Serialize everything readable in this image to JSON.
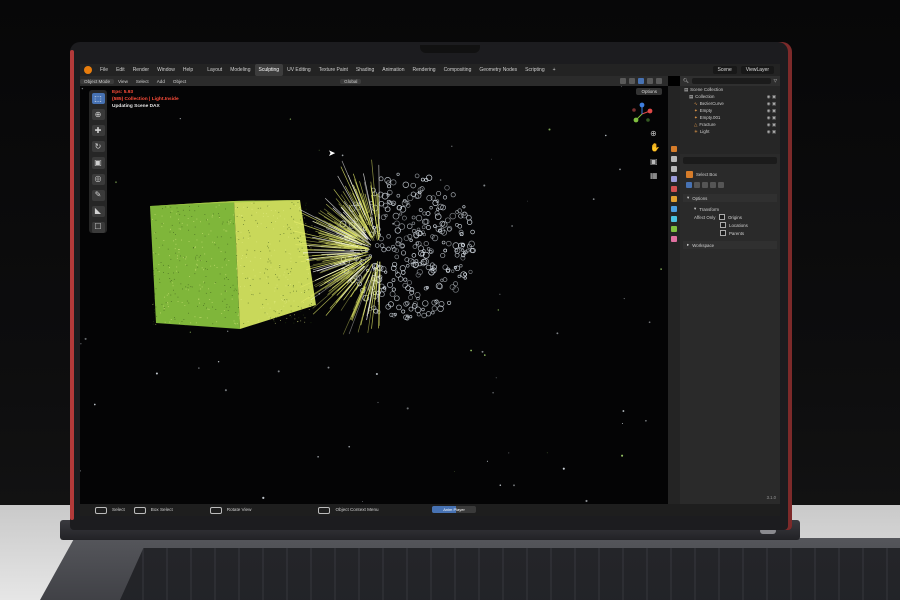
{
  "menubar": {
    "items": [
      "File",
      "Edit",
      "Render",
      "Window",
      "Help"
    ],
    "workspaces": [
      "Layout",
      "Modeling",
      "Sculpting",
      "UV Editing",
      "Texture Paint",
      "Shading",
      "Animation",
      "Rendering",
      "Compositing",
      "Geometry Nodes",
      "Scripting"
    ],
    "active_workspace": "Sculpting",
    "add_tab": "+",
    "scene": "Scene",
    "view_layer": "ViewLayer"
  },
  "viewport_header": {
    "mode": "Object Mode",
    "menus": [
      "View",
      "Select",
      "Add",
      "Object"
    ],
    "orientation": "Global",
    "options": "Options"
  },
  "viewport": {
    "stat_lines": [
      "Eps: 5.93",
      "(585) Collection | Light.Inside",
      "Updating Scene DAX"
    ]
  },
  "outliner": {
    "root": "Scene Collection",
    "rows": [
      {
        "label": "Collection",
        "level": 1
      },
      {
        "label": "BezierCurve",
        "level": 2
      },
      {
        "label": "Empty",
        "level": 2
      },
      {
        "label": "Empty.001",
        "level": 2
      },
      {
        "label": "Fracture",
        "level": 2
      },
      {
        "label": "Light",
        "level": 2
      }
    ]
  },
  "properties": {
    "active_tool": "Select Box",
    "options_panel": "Options",
    "transform_panel": "Transform",
    "affect_only_label": "Affect Only",
    "checks": [
      "Origins",
      "Locations",
      "Parents"
    ],
    "workspace_panel": "Workspace",
    "version": "3.1.0"
  },
  "statusbar": {
    "select": "Select",
    "box_select": "Box Select",
    "rotate_view": "Rotate View",
    "context_menu": "Object Context Menu",
    "progress_label": "Anim Player",
    "progress_fraction": 0.55
  },
  "colors": {
    "accent_blue": "#4772b3",
    "cube_green": "#7fb63a",
    "cube_yellow": "#c9d85a",
    "sphere_white": "#d8e0e8",
    "sphere_yellow": "#e5ec6a",
    "stat_red": "#ff4d3a"
  }
}
